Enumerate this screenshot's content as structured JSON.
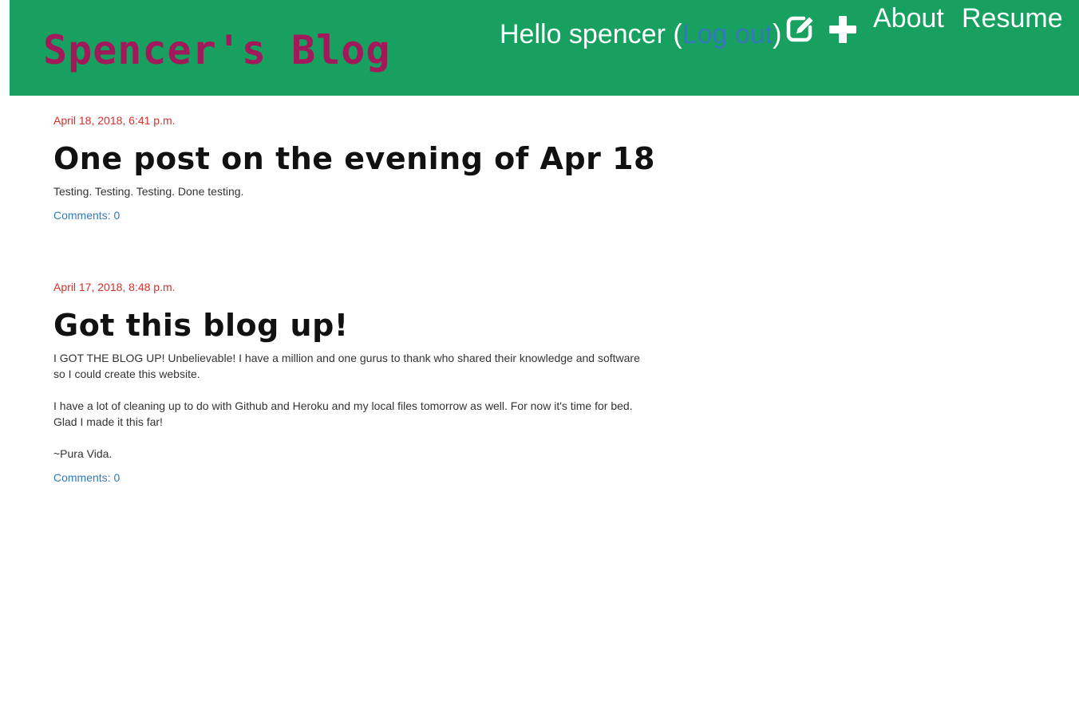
{
  "colors": {
    "header_bg": "#17a05f",
    "site_title": "#a1195a",
    "link": "#337ab7",
    "date": "#d9302c"
  },
  "header": {
    "site_title": "Spencer's Blog",
    "greeting_prefix": "Hello spencer (",
    "logout_label": "Log out",
    "greeting_suffix": ")",
    "new_post_icon": "edit-icon",
    "add_icon": "plus-icon",
    "nav": {
      "about": "About",
      "resume": "Resume"
    }
  },
  "posts": [
    {
      "date": "April 18, 2018, 6:41 p.m.",
      "title": "One post on the evening of Apr 18",
      "paragraphs": [
        "Testing. Testing. Testing. Done testing."
      ],
      "comments": "Comments: 0"
    },
    {
      "date": "April 17, 2018, 8:48 p.m.",
      "title": "Got this blog up!",
      "paragraphs": [
        "I GOT THE BLOG UP! Unbelievable! I have a million and one gurus to thank who shared their knowledge and software so I could create this website.",
        "I have a lot of cleaning up to do with Github and Heroku and my local files tomorrow as well. For now it's time for bed. Glad I made it this far!",
        "~Pura Vida."
      ],
      "comments": "Comments: 0"
    }
  ]
}
